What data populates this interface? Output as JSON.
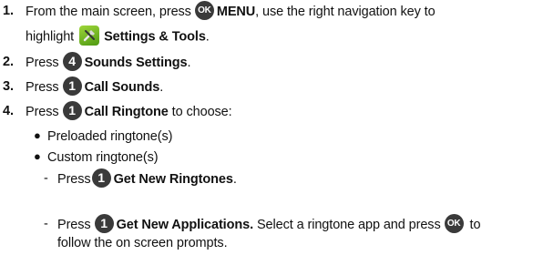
{
  "steps": [
    {
      "num": "1.",
      "line1": {
        "pre": "From the main screen, press",
        "key": "OK",
        "bold": "MENU",
        "post": ", use the right navigation key to"
      },
      "line2": {
        "pre": "highlight",
        "bold": "Settings & Tools",
        "post": "."
      }
    },
    {
      "num": "2.",
      "pre": "Press",
      "key": "4",
      "bold": "Sounds Settings",
      "post": "."
    },
    {
      "num": "3.",
      "pre": "Press",
      "key": "1",
      "bold": "Call Sounds",
      "post": "."
    },
    {
      "num": "4.",
      "pre": "Press",
      "key": "1",
      "bold": "Call Ringtone",
      "post": " to choose:"
    }
  ],
  "bullets": [
    "Preloaded ringtone(s)",
    "Custom ringtone(s)"
  ],
  "subitems": [
    {
      "dash": "-",
      "pre": "Press",
      "key": "1",
      "bold": "Get New Ringtones",
      "post": "."
    },
    {
      "dash": "-",
      "pre": "Press",
      "key": "1",
      "bold": "Get New Applications.",
      "mid": " Select a ringtone app and press",
      "key2": "OK",
      "post": " to",
      "line2": "follow the on screen prompts."
    }
  ],
  "icons": {
    "key": "circle-key-icon",
    "settings": "settings-tools-icon"
  },
  "colors": {
    "key_bg": "#3a3a3a",
    "settings_icon": "#6cb620"
  }
}
